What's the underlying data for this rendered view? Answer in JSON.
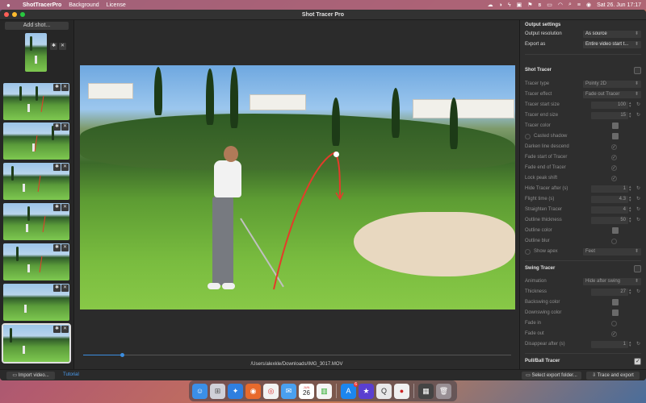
{
  "menubar": {
    "app_name": "ShotTracerPro",
    "menus": [
      "Background",
      "License"
    ],
    "clock": "Sat 26. Jun  17:17"
  },
  "window": {
    "title": "Shot Tracer Pro"
  },
  "sidebar": {
    "add_shot_label": "Add shot...",
    "thumb_remove": "✕",
    "thumb_settings": "✱"
  },
  "center": {
    "file_path": "/Users/alexkle/Downloads/IMG_3017.MOV",
    "playback_progress": 0.09
  },
  "panel": {
    "output_settings": {
      "title": "Output settings",
      "resolution_label": "Output resolution",
      "resolution_value": "As source",
      "export_label": "Export as",
      "export_value": "Entire video start t..."
    },
    "shot_tracer": {
      "title": "Shot Tracer",
      "enabled": false,
      "tracer_type_label": "Tracer type",
      "tracer_type_value": "Pointy 2D",
      "tracer_effect_label": "Tracer effect",
      "tracer_effect_value": "Fade out Tracer",
      "start_size_label": "Tracer start size",
      "start_size_value": "100",
      "end_size_label": "Tracer end size",
      "end_size_value": "15",
      "color_label": "Tracer color",
      "casted_shadow_label": "Casted shadow",
      "darken_label": "Darken line descend",
      "fade_start_label": "Fade start of Tracer",
      "fade_end_label": "Fade end of Tracer",
      "lock_peak_label": "Lock peak shift",
      "hide_after_label": "Hide Tracer after (s)",
      "hide_after_value": "1",
      "flight_time_label": "Flight time (s)",
      "flight_time_value": "4.3",
      "straighten_label": "Straighten Tracer",
      "straighten_value": "4",
      "outline_thickness_label": "Outline thickness",
      "outline_thickness_value": "50",
      "outline_color_label": "Outline color",
      "outline_blur_label": "Outline blur",
      "show_apex_label": "Show apex",
      "show_apex_value": "Feet"
    },
    "swing_tracer": {
      "title": "Swing Tracer",
      "enabled": false,
      "animation_label": "Animation",
      "animation_value": "Hide after swing",
      "thickness_label": "Thickness",
      "thickness_value": "27",
      "backswing_label": "Backswing color",
      "downswing_label": "Downswing color",
      "fade_in_label": "Fade in",
      "fade_out_label": "Fade out",
      "disappear_label": "Disappear after (s)",
      "disappear_value": "1"
    },
    "pull_ball_tracer": {
      "title": "Pull/Ball Tracer",
      "enabled": true
    }
  },
  "bottombar": {
    "import_label": "Import video...",
    "tutorial_label": "Tutorial",
    "select_folder_label": "Select export folder...",
    "trace_export_label": "Trace and export"
  },
  "dock": {
    "calendar_day": "26",
    "calendar_month": "JUN",
    "badge_count": "6"
  },
  "colors": {
    "accent": "#3c8ee0",
    "tracer_red": "#e53b2a",
    "panel_bg": "#2e2e2e"
  }
}
